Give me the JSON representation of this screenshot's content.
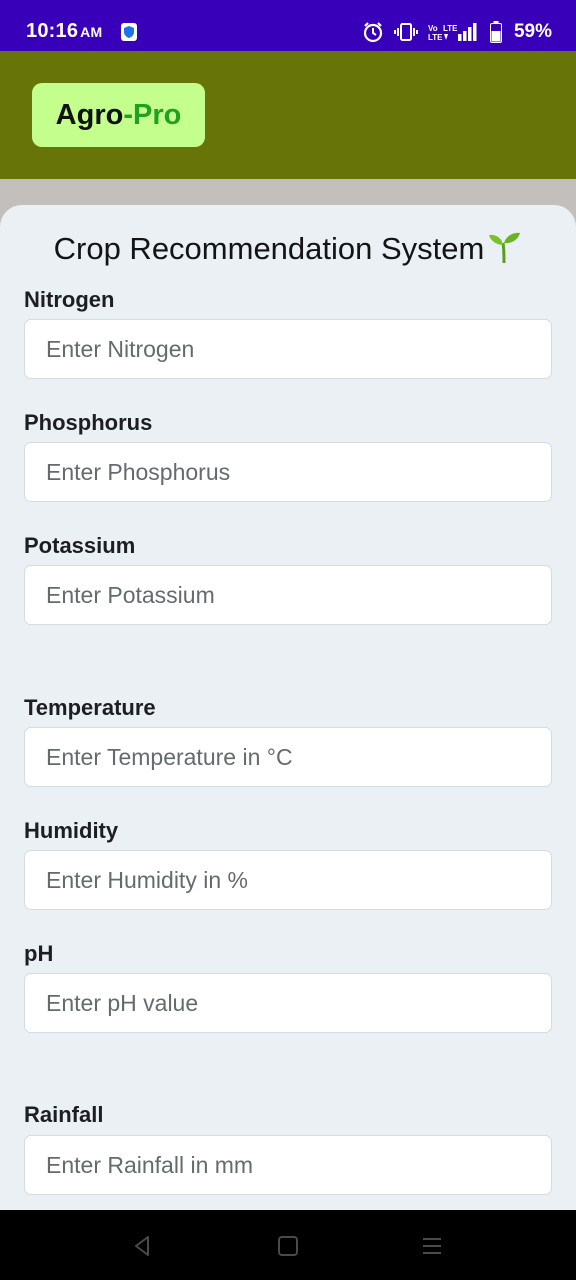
{
  "status_bar": {
    "time": "10:16",
    "ampm": "AM",
    "battery_text": "59%"
  },
  "header": {
    "logo_part1": "Agro",
    "logo_dash": "-",
    "logo_part2": "Pro"
  },
  "form": {
    "title": "Crop Recommendation System",
    "fields": [
      {
        "label": "Nitrogen",
        "placeholder": "Enter Nitrogen"
      },
      {
        "label": "Phosphorus",
        "placeholder": "Enter Phosphorus"
      },
      {
        "label": "Potassium",
        "placeholder": "Enter Potassium"
      },
      {
        "label": "Temperature",
        "placeholder": "Enter Temperature in °C"
      },
      {
        "label": "Humidity",
        "placeholder": "Enter Humidity in %"
      },
      {
        "label": "pH",
        "placeholder": "Enter pH value"
      },
      {
        "label": "Rainfall",
        "placeholder": "Enter Rainfall in mm"
      }
    ]
  },
  "colors": {
    "status_bar_bg": "#3800b8",
    "header_bg": "#677408",
    "logo_bg": "#c4ff8e",
    "logo_accent": "#21a021",
    "card_bg": "#ebf0f5"
  },
  "icons": {
    "security": "shield-icon",
    "alarm": "alarm-icon",
    "vibrate": "vibrate-icon",
    "signal": "signal-icon",
    "battery": "battery-icon",
    "title_emoji": "sprout-icon",
    "nav_back": "back-icon",
    "nav_home": "home-icon",
    "nav_menu": "menu-icon"
  }
}
